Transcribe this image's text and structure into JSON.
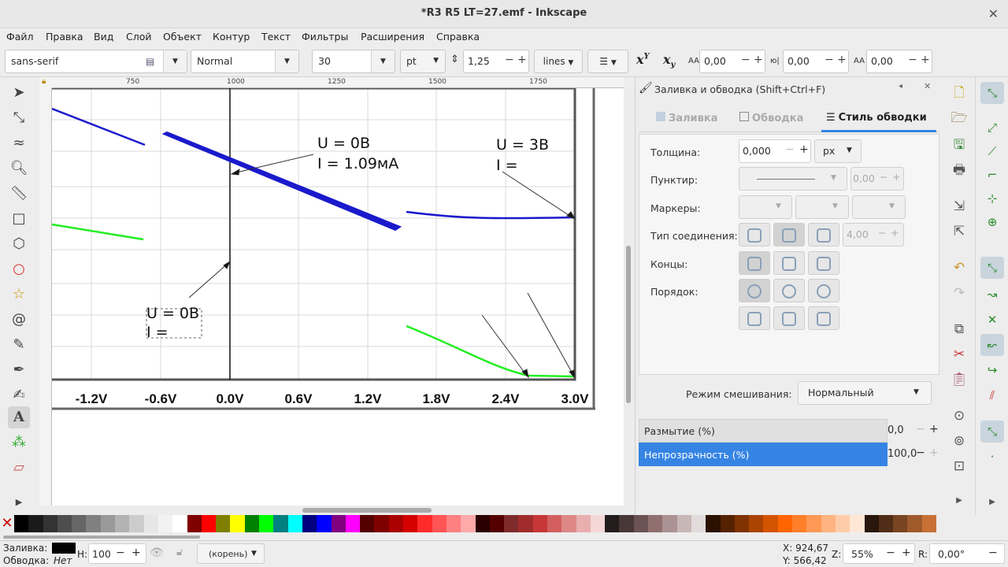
{
  "window": {
    "title": "*R3 R5 LT=27.emf - Inkscape"
  },
  "menu": [
    "Файл",
    "Правка",
    "Вид",
    "Слой",
    "Объект",
    "Контур",
    "Текст",
    "Фильтры",
    "Расширения",
    "Справка"
  ],
  "textbar": {
    "font_family": "sans-serif",
    "font_style": "Normal",
    "font_size": "30",
    "unit": "pt",
    "line_spacing": "1,25",
    "line_mode": "lines",
    "letter_spacing": "0,00",
    "word_spacing": "0,00",
    "kerning": "0,00"
  },
  "ruler": {
    "h_ticks": [
      "750",
      "1000",
      "1250",
      "1500",
      "1750"
    ]
  },
  "canvas": {
    "x_axis_labels": [
      "-1.2V",
      "-0.6V",
      "0.0V",
      "0.6V",
      "1.2V",
      "1.8V",
      "2.4V",
      "3.0V"
    ],
    "ann1_line1": "U = 0В",
    "ann1_line2": "I = 1.09мА",
    "ann2_line1": "U = 3В",
    "ann2_line2": "I =",
    "ann3_line1": "U = 0В",
    "ann3_line2": "I ="
  },
  "dock": {
    "title": "Заливка и обводка (Shift+Ctrl+F)",
    "tabs": [
      "Заливка",
      "Обводка",
      "Стиль обводки"
    ],
    "width_label": "Толщина:",
    "width_value": "0,000",
    "width_unit": "px",
    "dash_label": "Пунктир:",
    "dash_offset": "0,00",
    "markers_label": "Маркеры:",
    "join_label": "Тип соединения:",
    "miter_value": "4,00",
    "caps_label": "Концы:",
    "order_label": "Порядок:",
    "blend_label": "Режим смешивания:",
    "blend_value": "Нормальный",
    "blur_label": "Размытие (%)",
    "blur_value": "0,0",
    "opacity_label": "Непрозрачность (%)",
    "opacity_value": "100,0"
  },
  "status": {
    "fill_label": "Заливка:",
    "stroke_label": "Обводка:",
    "stroke_value": "Нет",
    "h_label": "H:",
    "h_value": "100",
    "layer": "(корень)",
    "x_coord": "X: 924,67",
    "y_coord": "Y: 566,42",
    "zoom_label": "Z:",
    "zoom": "55%",
    "rot_label": "R:",
    "rotation": "0,00°"
  },
  "colors": {
    "accent": "#3584e4",
    "curve_blue": "#1a1acc",
    "curve_green": "#22ee22",
    "palette": [
      "#000000",
      "#1a1a1a",
      "#333333",
      "#4d4d4d",
      "#666666",
      "#808080",
      "#999999",
      "#b3b3b3",
      "#cccccc",
      "#e6e6e6",
      "#f2f2f2",
      "#ffffff",
      "#800000",
      "#ff0000",
      "#808000",
      "#ffff00",
      "#008000",
      "#00ff00",
      "#008080",
      "#00ffff",
      "#000080",
      "#0000ff",
      "#800080",
      "#ff00ff",
      "#550000",
      "#800000",
      "#aa0000",
      "#d40000",
      "#ff2a2a",
      "#ff5555",
      "#ff8080",
      "#ffaaaa",
      "#2b0000",
      "#550000",
      "#802b2b",
      "#a02c2c",
      "#c83737",
      "#d35f5f",
      "#de8787",
      "#e9afaf",
      "#f4d7d7",
      "#241c1c",
      "#483737",
      "#6c5353",
      "#916f6f",
      "#ac9393",
      "#c8b7b7",
      "#e3dbdb",
      "#2b1100",
      "#552200",
      "#803300",
      "#aa4400",
      "#d45500",
      "#ff6600",
      "#ff7f2a",
      "#ff9955",
      "#ffb380",
      "#ffccaa",
      "#ffe6d5",
      "#28170b",
      "#502d16",
      "#784421",
      "#a05a2c",
      "#c87137"
    ]
  }
}
